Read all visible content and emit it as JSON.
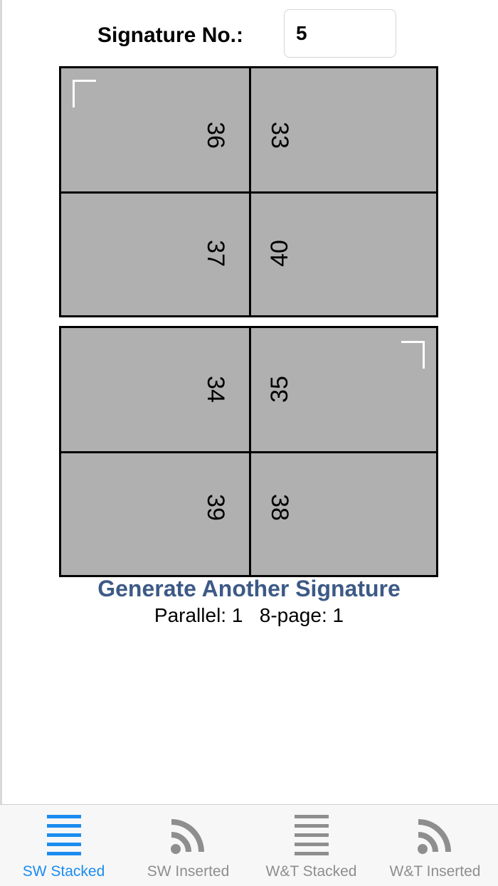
{
  "header": {
    "signature_label": "Signature No.:",
    "signature_value": "5"
  },
  "sheets": [
    {
      "pages": [
        {
          "number": "36",
          "orientation": "cw"
        },
        {
          "number": "33",
          "orientation": "cw"
        },
        {
          "number": "37",
          "orientation": "cw"
        },
        {
          "number": "40",
          "orientation": "ccw"
        }
      ]
    },
    {
      "pages": [
        {
          "number": "34",
          "orientation": "cw"
        },
        {
          "number": "35",
          "orientation": "ccw"
        },
        {
          "number": "39",
          "orientation": "cw"
        },
        {
          "number": "38",
          "orientation": "cw"
        }
      ]
    }
  ],
  "generate_label": "Generate Another Signature",
  "counts": "Parallel: 1   8-page: 1",
  "tabs": [
    {
      "label": "SW Stacked",
      "icon": "list-icon",
      "active": true
    },
    {
      "label": "SW Inserted",
      "icon": "rss-icon",
      "active": false
    },
    {
      "label": "W&T Stacked",
      "icon": "list-icon",
      "active": false
    },
    {
      "label": "W&T Inserted",
      "icon": "rss-icon",
      "active": false
    }
  ],
  "colors": {
    "accent": "#1a8cf0",
    "link": "#3d5a86",
    "sheet_fill": "#b0b0b0",
    "inactive_icon": "#8e8e8e"
  }
}
